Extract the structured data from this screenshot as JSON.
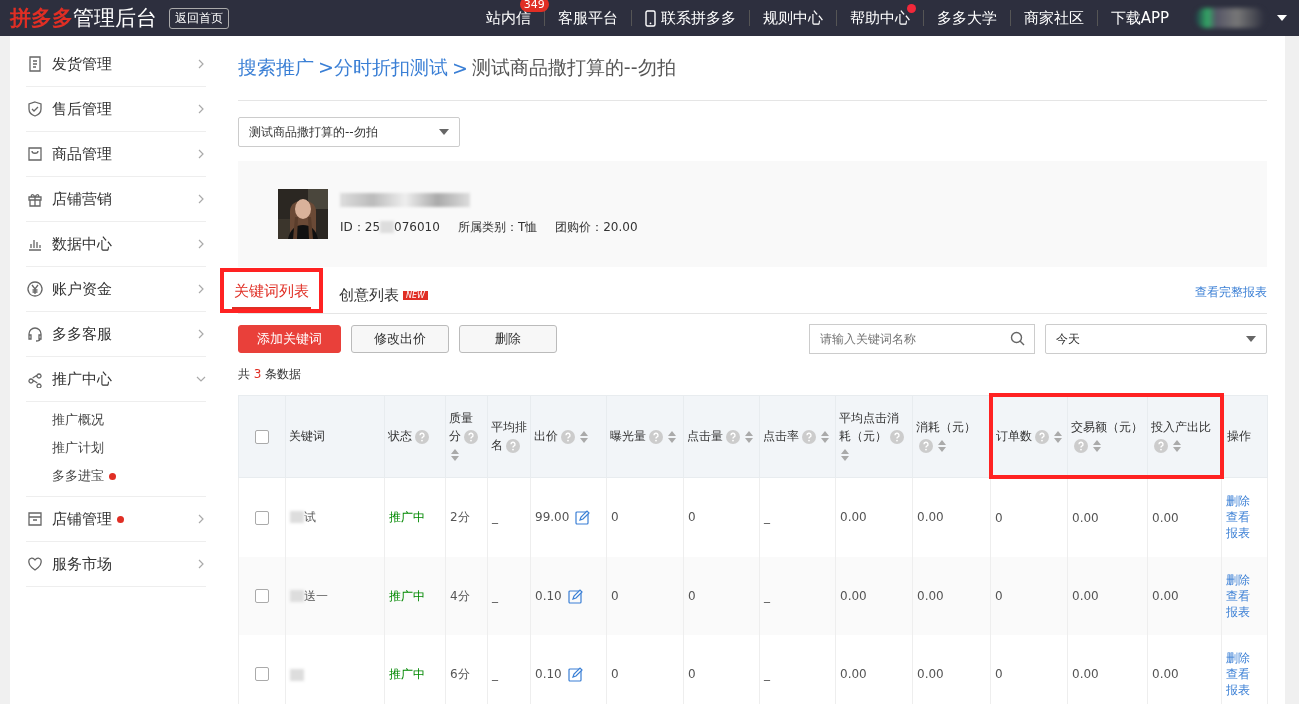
{
  "topbar": {
    "logo_brand": "拼多多",
    "logo_suffix": "管理后台",
    "home_button": "返回首页",
    "nav": [
      {
        "label": "站内信",
        "badge": "349"
      },
      {
        "label": "客服平台"
      },
      {
        "label": "联系拼多多"
      },
      {
        "label": "规则中心"
      },
      {
        "label": "帮助中心",
        "dot": true
      },
      {
        "label": "多多大学"
      },
      {
        "label": "商家社区"
      },
      {
        "label": "下载APP"
      }
    ]
  },
  "sidebar": {
    "items": [
      {
        "label": "发货管理",
        "expanded": false
      },
      {
        "label": "售后管理",
        "expanded": false
      },
      {
        "label": "商品管理",
        "expanded": false
      },
      {
        "label": "店铺营销",
        "expanded": false
      },
      {
        "label": "数据中心",
        "expanded": false
      },
      {
        "label": "账户资金",
        "expanded": false
      },
      {
        "label": "多多客服",
        "expanded": false
      },
      {
        "label": "推广中心",
        "expanded": true,
        "children": [
          {
            "label": "推广概况"
          },
          {
            "label": "推广计划"
          },
          {
            "label": "多多进宝",
            "dot": true
          }
        ]
      },
      {
        "label": "店铺管理",
        "expanded": false,
        "dot": true
      },
      {
        "label": "服务市场",
        "expanded": false
      }
    ]
  },
  "breadcrumb": [
    {
      "label": "搜索推广",
      "link": true
    },
    {
      "label": ">分时折扣测试",
      "link": true
    },
    {
      "label": ">",
      "link": true
    },
    {
      "label": "测试商品撒打算的--勿拍",
      "link": false
    }
  ],
  "product_select": {
    "value": "测试商品撒打算的--勿拍"
  },
  "product": {
    "kind": "picture",
    "id_prefix": "ID：25",
    "id_suffix": "076010",
    "category": "所属类别：T恤",
    "price": "团购价：20.00"
  },
  "tabs": [
    {
      "label": "关键词列表",
      "selected": true,
      "highlighted": true
    },
    {
      "label": "创意列表",
      "selected": false,
      "badge": "NEW"
    }
  ],
  "full_report_link": "查看完整报表",
  "buttons": [
    {
      "label": "添加关键词",
      "kind": "primary"
    },
    {
      "label": "修改出价",
      "kind": "default"
    },
    {
      "label": "删除",
      "kind": "default"
    }
  ],
  "search": {
    "placeholder": "请输入关键词名称"
  },
  "date_select": {
    "value": "今天"
  },
  "count": {
    "prefix": "共",
    "number": "3",
    "suffix": "条数据"
  },
  "table": {
    "header_checkbox": {
      "checked": false
    },
    "columns": [
      {
        "label": "关键词",
        "help": false,
        "sortable": false,
        "highlighted": false
      },
      {
        "label": "状态",
        "help": true,
        "sortable": false,
        "highlighted": false
      },
      {
        "label": "质量分",
        "help": true,
        "sortable": true,
        "highlighted": false
      },
      {
        "label": "平均排名",
        "help": true,
        "sortable": false,
        "highlighted": false
      },
      {
        "label": "出价",
        "help": true,
        "sortable": true,
        "highlighted": false
      },
      {
        "label": "曝光量",
        "help": true,
        "sortable": true,
        "highlighted": false
      },
      {
        "label": "点击量",
        "help": true,
        "sortable": true,
        "highlighted": false
      },
      {
        "label": "点击率",
        "help": true,
        "sortable": true,
        "highlighted": false
      },
      {
        "label": "平均点击消耗（元）",
        "help": true,
        "sortable": true,
        "highlighted": false
      },
      {
        "label": "消耗（元）",
        "help": true,
        "sortable": true,
        "highlighted": false
      },
      {
        "label": "订单数",
        "help": true,
        "sortable": true,
        "highlighted": true
      },
      {
        "label": "交易额（元）",
        "help": true,
        "sortable": true,
        "highlighted": true
      },
      {
        "label": "投入产出比",
        "help": true,
        "sortable": true,
        "highlighted": true
      },
      {
        "label": "操作",
        "help": false,
        "sortable": false,
        "highlighted": false
      }
    ],
    "rows": [
      {
        "checked": false,
        "keyword": "试",
        "status": "推广中",
        "quality": "2分",
        "rank": "_",
        "bid": "99.00",
        "impressions": "0",
        "clicks": "0",
        "ctr": "_",
        "avg_cost": "0.00",
        "spend": "0.00",
        "orders": "0",
        "gmv": "0.00",
        "roi": "0.00",
        "actions": [
          "删除",
          "查看",
          "报表"
        ]
      },
      {
        "checked": false,
        "keyword": "送一",
        "status": "推广中",
        "quality": "4分",
        "rank": "_",
        "bid": "0.10",
        "impressions": "0",
        "clicks": "0",
        "ctr": "_",
        "avg_cost": "0.00",
        "spend": "0.00",
        "orders": "0",
        "gmv": "0.00",
        "roi": "0.00",
        "actions": [
          "删除",
          "查看",
          "报表"
        ]
      },
      {
        "checked": false,
        "status": "推广中",
        "quality": "6分",
        "rank": "_",
        "bid": "0.10",
        "impressions": "0",
        "clicks": "0",
        "ctr": "_",
        "avg_cost": "0.00",
        "spend": "0.00",
        "orders": "0",
        "gmv": "0.00",
        "roi": "0.00",
        "actions": [
          "删除",
          "查看",
          "报表"
        ]
      }
    ]
  }
}
